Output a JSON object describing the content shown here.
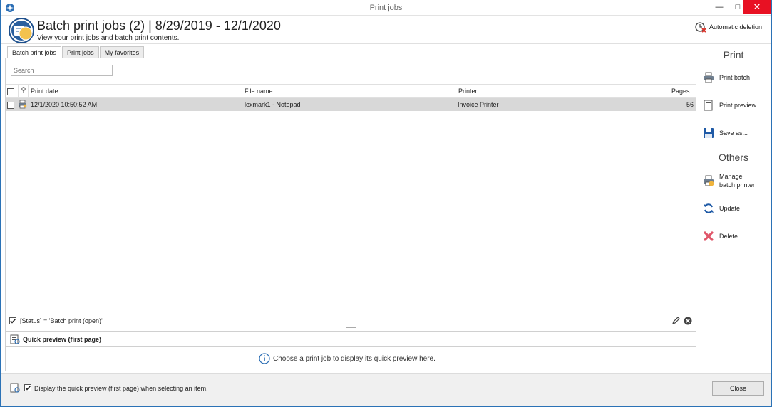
{
  "window": {
    "title": "Print jobs",
    "minimize": "—",
    "maximize": "□",
    "close": "✕"
  },
  "header": {
    "title": "Batch print jobs (2) | 8/29/2019 - 12/1/2020",
    "subtitle": "View your print jobs and batch print contents.",
    "auto_delete": "Automatic deletion"
  },
  "tabs": [
    {
      "label": "Batch print jobs",
      "active": true
    },
    {
      "label": "Print jobs",
      "active": false
    },
    {
      "label": "My favorites",
      "active": false
    }
  ],
  "search": {
    "placeholder": "Search"
  },
  "grid": {
    "columns": [
      "Print date",
      "File name",
      "Printer",
      "Pages"
    ],
    "rows": [
      {
        "print_date": "12/1/2020 10:50:52 AM",
        "file_name": "lexmark1 - Notepad",
        "printer": "Invoice Printer",
        "pages": "56"
      }
    ]
  },
  "filter": {
    "text": "[Status] = 'Batch print (open)'"
  },
  "quick_preview": {
    "title": "Quick preview (first page)",
    "message": "Choose a print job to display its quick preview here."
  },
  "sidebar": {
    "print_heading": "Print",
    "print_items": [
      {
        "label": "Print batch",
        "icon": "printer-icon"
      },
      {
        "label": "Print preview",
        "icon": "print-preview-icon"
      },
      {
        "label": "Save as...",
        "icon": "floppy-disk-icon"
      }
    ],
    "others_heading": "Others",
    "manage_line1": "Manage",
    "manage_line2": "batch printer",
    "update_label": "Update",
    "delete_label": "Delete"
  },
  "footer": {
    "checkbox_label": "Display the quick preview (first page) when selecting an item.",
    "close_label": "Close"
  }
}
